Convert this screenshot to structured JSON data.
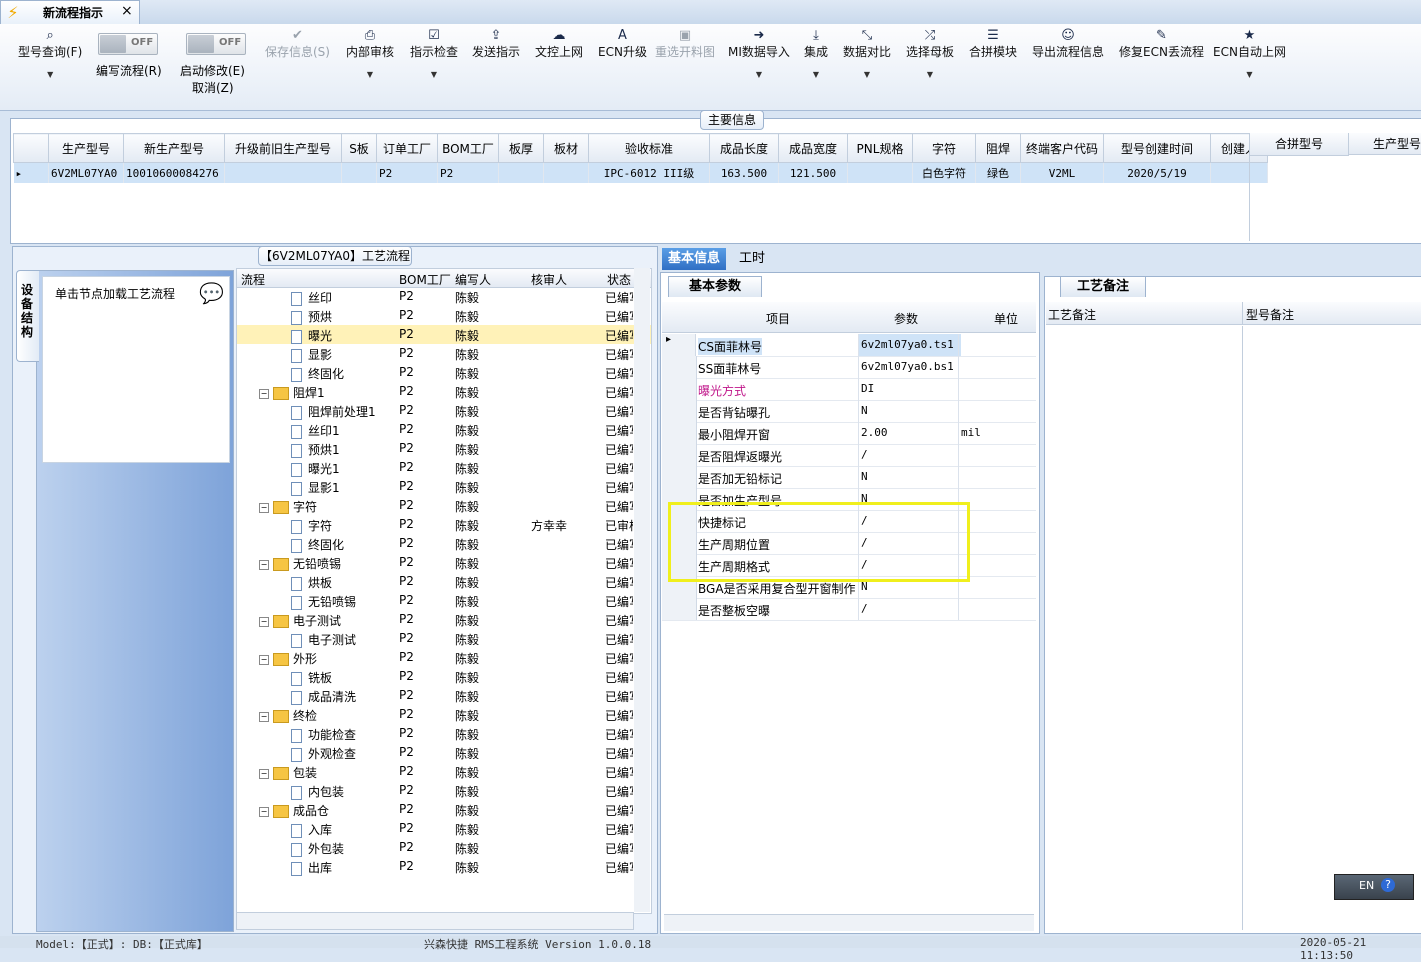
{
  "tab": {
    "title": "新流程指示",
    "close": "×"
  },
  "toolbar": {
    "model_query": "型号查询(F)",
    "edit_flow_toggle": "OFF",
    "edit_flow": "编写流程(R)",
    "start_modify_toggle": "OFF",
    "start_modify": "启动修改(E)",
    "cancel": "取消(Z)",
    "save_info": "保存信息(S)",
    "internal_review": "内部审核",
    "instruction_check": "指示检查",
    "send_instruction": "发送指示",
    "control_upload": "文控上网",
    "ecn_upgrade": "ECN升级",
    "reselect_material": "重选开料图",
    "mi_import": "MI数据导入",
    "integrate": "集成",
    "data_compare": "数据对比",
    "select_master": "选择母板",
    "merge_module": "合拼模块",
    "export_flow": "导出流程信息",
    "fix_ecn": "修复ECN丢流程",
    "ecn_auto": "ECN自动上网"
  },
  "main_info": {
    "caption": "主要信息",
    "headers": [
      "生产型号",
      "新生产型号",
      "升级前旧生产型号",
      "S板",
      "订单工厂",
      "BOM工厂",
      "板厚",
      "板材",
      "验收标准",
      "成品长度",
      "成品宽度",
      "PNL规格",
      "字符",
      "阻焊",
      "终端客户代码",
      "型号创建时间",
      "创建人"
    ],
    "row": [
      "6V2ML07YA0",
      "10010600084276",
      "",
      "",
      "P2",
      "P2",
      "",
      "",
      "IPC-6012 III级",
      "163.500",
      "121.500",
      "",
      "白色字符",
      "绿色",
      "V2ML",
      "2020/5/19",
      ""
    ],
    "side_headers": [
      "合拼型号",
      "生产型号"
    ]
  },
  "flow": {
    "caption": "【6V2ML07YA0】工艺流程",
    "vtab": "设备结构",
    "hint": "单击节点加载工艺流程",
    "headers": [
      "流程",
      "BOM工厂",
      "编写人",
      "核审人",
      "状态"
    ],
    "rows": [
      {
        "name": "丝印",
        "level": 2,
        "factory": "P2",
        "writer": "陈毅",
        "reviewer": "",
        "status": "已编写"
      },
      {
        "name": "预烘",
        "level": 2,
        "factory": "P2",
        "writer": "陈毅",
        "reviewer": "",
        "status": "已编写"
      },
      {
        "name": "曝光",
        "level": 2,
        "factory": "P2",
        "writer": "陈毅",
        "reviewer": "",
        "status": "已编写"
      },
      {
        "name": "显影",
        "level": 2,
        "factory": "P2",
        "writer": "陈毅",
        "reviewer": "",
        "status": "已编写"
      },
      {
        "name": "终固化",
        "level": 2,
        "factory": "P2",
        "writer": "陈毅",
        "reviewer": "",
        "status": "已编写"
      },
      {
        "name": "阻焊1",
        "level": 1,
        "factory": "P2",
        "writer": "陈毅",
        "reviewer": "",
        "status": "已编写"
      },
      {
        "name": "阻焊前处理1",
        "level": 2,
        "factory": "P2",
        "writer": "陈毅",
        "reviewer": "",
        "status": "已编写"
      },
      {
        "name": "丝印1",
        "level": 2,
        "factory": "P2",
        "writer": "陈毅",
        "reviewer": "",
        "status": "已编写"
      },
      {
        "name": "预烘1",
        "level": 2,
        "factory": "P2",
        "writer": "陈毅",
        "reviewer": "",
        "status": "已编写"
      },
      {
        "name": "曝光1",
        "level": 2,
        "factory": "P2",
        "writer": "陈毅",
        "reviewer": "",
        "status": "已编写"
      },
      {
        "name": "显影1",
        "level": 2,
        "factory": "P2",
        "writer": "陈毅",
        "reviewer": "",
        "status": "已编写"
      },
      {
        "name": "字符",
        "level": 1,
        "factory": "P2",
        "writer": "陈毅",
        "reviewer": "",
        "status": "已编写"
      },
      {
        "name": "字符",
        "level": 2,
        "factory": "P2",
        "writer": "陈毅",
        "reviewer": "方幸幸",
        "status": "已审核"
      },
      {
        "name": "终固化",
        "level": 2,
        "factory": "P2",
        "writer": "陈毅",
        "reviewer": "",
        "status": "已编写"
      },
      {
        "name": "无铅喷锡",
        "level": 1,
        "factory": "P2",
        "writer": "陈毅",
        "reviewer": "",
        "status": "已编写"
      },
      {
        "name": "烘板",
        "level": 2,
        "factory": "P2",
        "writer": "陈毅",
        "reviewer": "",
        "status": "已编写"
      },
      {
        "name": "无铅喷锡",
        "level": 2,
        "factory": "P2",
        "writer": "陈毅",
        "reviewer": "",
        "status": "已编写"
      },
      {
        "name": "电子测试",
        "level": 1,
        "factory": "P2",
        "writer": "陈毅",
        "reviewer": "",
        "status": "已编写"
      },
      {
        "name": "电子测试",
        "level": 2,
        "factory": "P2",
        "writer": "陈毅",
        "reviewer": "",
        "status": "已编写"
      },
      {
        "name": "外形",
        "level": 1,
        "factory": "P2",
        "writer": "陈毅",
        "reviewer": "",
        "status": "已编写"
      },
      {
        "name": "铣板",
        "level": 2,
        "factory": "P2",
        "writer": "陈毅",
        "reviewer": "",
        "status": "已编写"
      },
      {
        "name": "成品清洗",
        "level": 2,
        "factory": "P2",
        "writer": "陈毅",
        "reviewer": "",
        "status": "已编写"
      },
      {
        "name": "终检",
        "level": 1,
        "factory": "P2",
        "writer": "陈毅",
        "reviewer": "",
        "status": "已编写"
      },
      {
        "name": "功能检查",
        "level": 2,
        "factory": "P2",
        "writer": "陈毅",
        "reviewer": "",
        "status": "已编写"
      },
      {
        "name": "外观检查",
        "level": 2,
        "factory": "P2",
        "writer": "陈毅",
        "reviewer": "",
        "status": "已编写"
      },
      {
        "name": "包装",
        "level": 1,
        "factory": "P2",
        "writer": "陈毅",
        "reviewer": "",
        "status": "已编写"
      },
      {
        "name": "内包装",
        "level": 2,
        "factory": "P2",
        "writer": "陈毅",
        "reviewer": "",
        "status": "已编写"
      },
      {
        "name": "成品仓",
        "level": 1,
        "factory": "P2",
        "writer": "陈毅",
        "reviewer": "",
        "status": "已编写"
      },
      {
        "name": "入库",
        "level": 2,
        "factory": "P2",
        "writer": "陈毅",
        "reviewer": "",
        "status": "已编写"
      },
      {
        "name": "外包装",
        "level": 2,
        "factory": "P2",
        "writer": "陈毅",
        "reviewer": "",
        "status": "已编写"
      },
      {
        "name": "出库",
        "level": 2,
        "factory": "P2",
        "writer": "陈毅",
        "reviewer": "",
        "status": "已编写"
      }
    ]
  },
  "right_tabs": {
    "basic_info": "基本信息",
    "work_hours": "工时"
  },
  "params": {
    "tab": "基本参数",
    "headers": [
      "项目",
      "参数",
      "单位"
    ],
    "rows": [
      {
        "item": "CS面菲林号",
        "value": "6v2ml07ya0.ts1",
        "unit": ""
      },
      {
        "item": "SS面菲林号",
        "value": "6v2ml07ya0.bs1",
        "unit": ""
      },
      {
        "item": "曝光方式",
        "value": "DI",
        "unit": "",
        "color": "#c0168a"
      },
      {
        "item": "是否背钻曝孔",
        "value": "N",
        "unit": ""
      },
      {
        "item": "最小阻焊开窗",
        "value": "2.00",
        "unit": "mil"
      },
      {
        "item": "是否阻焊返曝光",
        "value": "/",
        "unit": ""
      },
      {
        "item": "是否加无铅标记",
        "value": "N",
        "unit": ""
      },
      {
        "item": "是否加生产型号",
        "value": "N",
        "unit": ""
      },
      {
        "item": "快捷标记",
        "value": "/",
        "unit": ""
      },
      {
        "item": "生产周期位置",
        "value": "/",
        "unit": ""
      },
      {
        "item": "生产周期格式",
        "value": "/",
        "unit": ""
      },
      {
        "item": "BGA是否采用复合型开窗制作",
        "value": "N",
        "unit": ""
      },
      {
        "item": "是否整板空曝",
        "value": "/",
        "unit": ""
      }
    ]
  },
  "notes": {
    "tab": "工艺备注",
    "col1": "工艺备注",
    "col2": "型号备注"
  },
  "lang": {
    "code": "EN",
    "help": "?"
  },
  "status": {
    "left": "Model:【正式】: DB:【正式库】",
    "center": "兴森快捷 RMS工程系统 Version 1.0.0.18",
    "right": "2020-05-21 11:13:50"
  }
}
